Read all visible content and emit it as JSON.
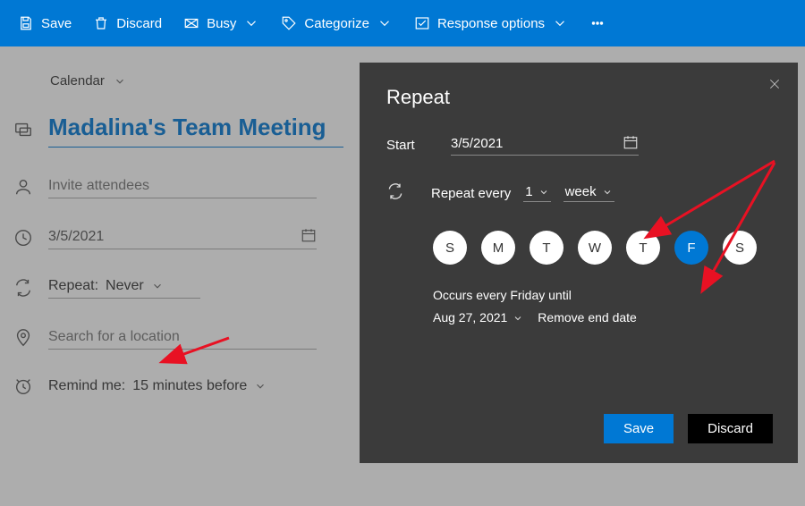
{
  "toolbar": {
    "save": "Save",
    "discard": "Discard",
    "busy": "Busy",
    "categorize": "Categorize",
    "response_options": "Response options"
  },
  "calendar_picker": {
    "label": "Calendar"
  },
  "event": {
    "title": "Madalina's Team Meeting",
    "attendees_placeholder": "Invite attendees",
    "date": "3/5/2021",
    "repeat_label": "Repeat:",
    "repeat_value": "Never",
    "location_placeholder": "Search for a location",
    "remind_label": "Remind me:",
    "remind_value": "15 minutes before"
  },
  "modal": {
    "title": "Repeat",
    "start_label": "Start",
    "start_date": "3/5/2021",
    "repeat_every_label": "Repeat every",
    "interval": "1",
    "unit": "week",
    "days": [
      "S",
      "M",
      "T",
      "W",
      "T",
      "F",
      "S"
    ],
    "selected_day_index": 5,
    "occurs_text": "Occurs every Friday until",
    "until_date": "Aug 27, 2021",
    "remove_end": "Remove end date",
    "save": "Save",
    "discard": "Discard"
  },
  "colors": {
    "accent": "#0078d4"
  }
}
